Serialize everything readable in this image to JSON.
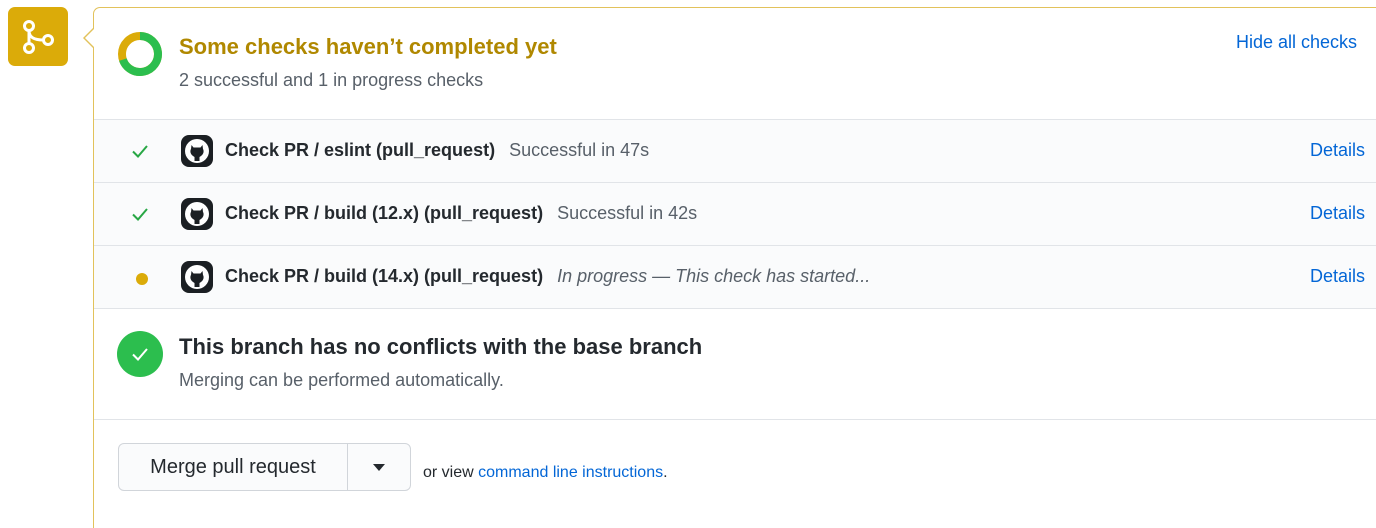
{
  "status": {
    "title": "Some checks haven’t completed yet",
    "subtitle": "2 successful and 1 in progress checks",
    "hide_link": "Hide all checks"
  },
  "checks": [
    {
      "name": "Check PR / eslint (pull_request)",
      "description": "Successful in 47s",
      "state": "success",
      "details": "Details"
    },
    {
      "name": "Check PR / build (12.x) (pull_request)",
      "description": "Successful in 42s",
      "state": "success",
      "details": "Details"
    },
    {
      "name": "Check PR / build (14.x) (pull_request)",
      "description": "In progress — This check has started...",
      "state": "in_progress",
      "details": "Details"
    }
  ],
  "conflicts": {
    "title": "This branch has no conflicts with the base branch",
    "subtitle": "Merging can be performed automatically."
  },
  "merge": {
    "button_label": "Merge pull request",
    "or_view": "or view ",
    "command_link": "command line instructions",
    "period": "."
  },
  "colors": {
    "pending": "#dbab09",
    "success": "#2cbe4e",
    "link": "#0366d6",
    "pending_text": "#b08800"
  },
  "icons": {
    "merge": "git-merge-icon",
    "check": "check-icon",
    "pending_dot": "dot-fill-icon",
    "github": "github-mark-icon"
  }
}
